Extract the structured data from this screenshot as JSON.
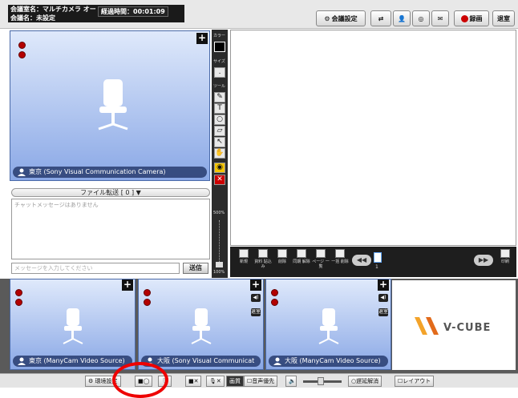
{
  "header": {
    "meeting_name": "会議室名：マルチカメラ オー",
    "meeting_title": "会議名：未設定",
    "elapsed_label": "経過時間：00:01:09",
    "settings_label": "会議設定",
    "record_label": "録画",
    "leave_label": "退室"
  },
  "main_video": {
    "camera_label": "東京 (Sony Visual Communication Camera)"
  },
  "toolbar": {
    "color_label": "カラー",
    "size_label": "サイズ",
    "tool_label": "ツール",
    "zoom_top": "500%",
    "zoom_bottom": "100%"
  },
  "board_bar": {
    "buttons": [
      "新規",
      "資料\n貼込み",
      "削除",
      "同期\n解除",
      "ページ\n一覧",
      "一括\n削除"
    ],
    "page_number": "1",
    "print_label": "印刷"
  },
  "chat": {
    "file_transfer": "ファイル転送 [ 0 ]",
    "empty_message": "チャットメッセージはありません",
    "input_placeholder": "メッセージを入力してください",
    "send_label": "送信"
  },
  "thumbnails": [
    {
      "label": "東京 (ManyCam Video Source)"
    },
    {
      "label": "大阪 (Sony Visual Communicat"
    },
    {
      "label": "大阪 (ManyCam Video Source)"
    }
  ],
  "thumb_badge": "退室",
  "logo_text": "V-CUBE",
  "footer": {
    "env_settings": "環境設定",
    "speaker_priority": "音声優先",
    "delay_release": "遅延解消",
    "layout": "レイアウト",
    "quality_label": "画質"
  },
  "colors": {
    "video_top": "#dfe9fb",
    "video_bottom": "#8aa8e6",
    "accent_red": "#e00000"
  }
}
